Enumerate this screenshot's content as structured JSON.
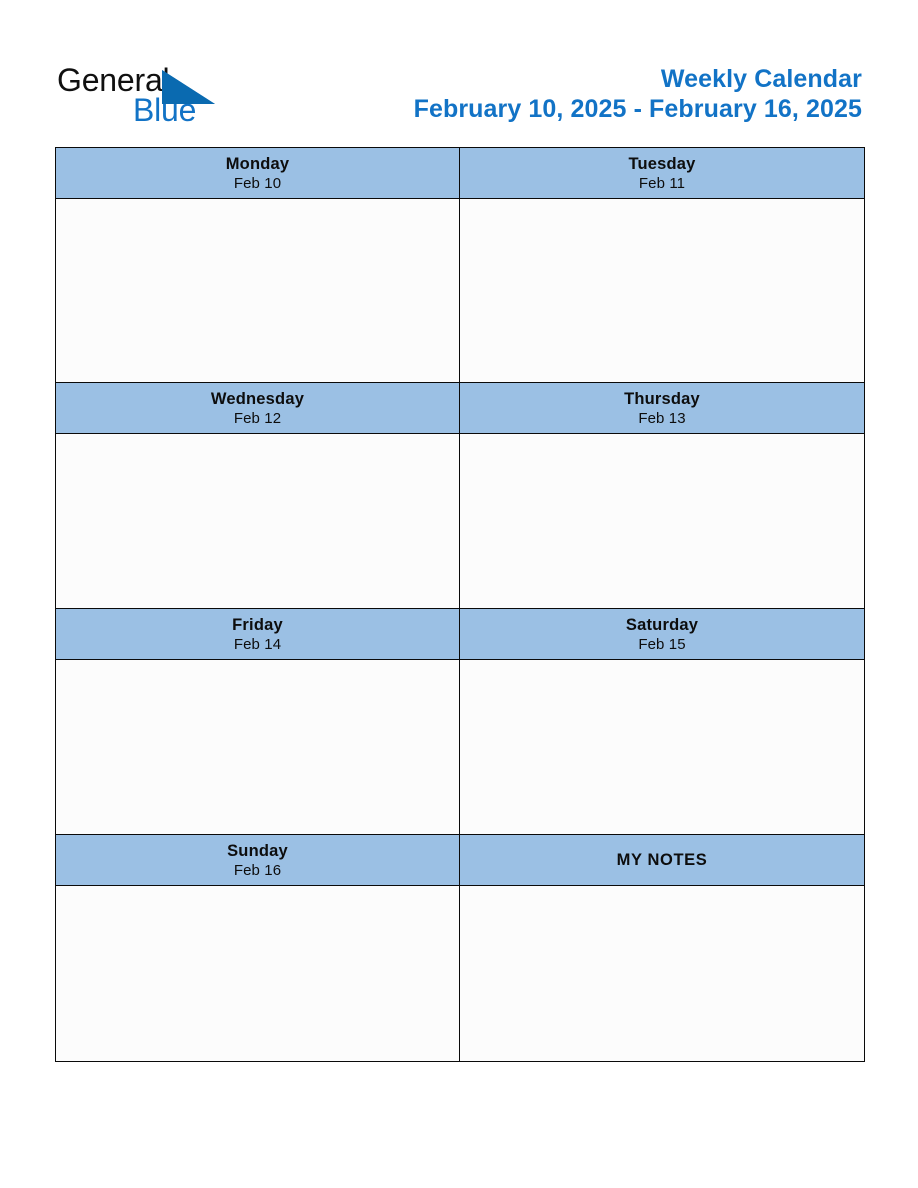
{
  "brand": {
    "name_part1": "General",
    "name_part2": "Blue",
    "triangle_color": "#0A6AB0",
    "blue_text_color": "#1273C6",
    "dark_text_color": "#101010"
  },
  "header": {
    "title": "Weekly Calendar",
    "date_range": "February 10, 2025 - February 16, 2025",
    "title_color": "#1273C6"
  },
  "calendar": {
    "header_bg": "#9BC0E4",
    "cell_bg": "#FCFCFC",
    "border_color": "#0A0A0A",
    "notes_label": "MY NOTES",
    "rows": [
      {
        "left": {
          "day": "Monday",
          "date": "Feb 10",
          "content": ""
        },
        "right": {
          "day": "Tuesday",
          "date": "Feb 11",
          "content": ""
        }
      },
      {
        "left": {
          "day": "Wednesday",
          "date": "Feb 12",
          "content": ""
        },
        "right": {
          "day": "Thursday",
          "date": "Feb 13",
          "content": ""
        }
      },
      {
        "left": {
          "day": "Friday",
          "date": "Feb 14",
          "content": ""
        },
        "right": {
          "day": "Saturday",
          "date": "Feb 15",
          "content": ""
        }
      },
      {
        "left": {
          "day": "Sunday",
          "date": "Feb 16",
          "content": ""
        },
        "right": {
          "day": "MY NOTES",
          "date": "",
          "content": ""
        }
      }
    ]
  }
}
